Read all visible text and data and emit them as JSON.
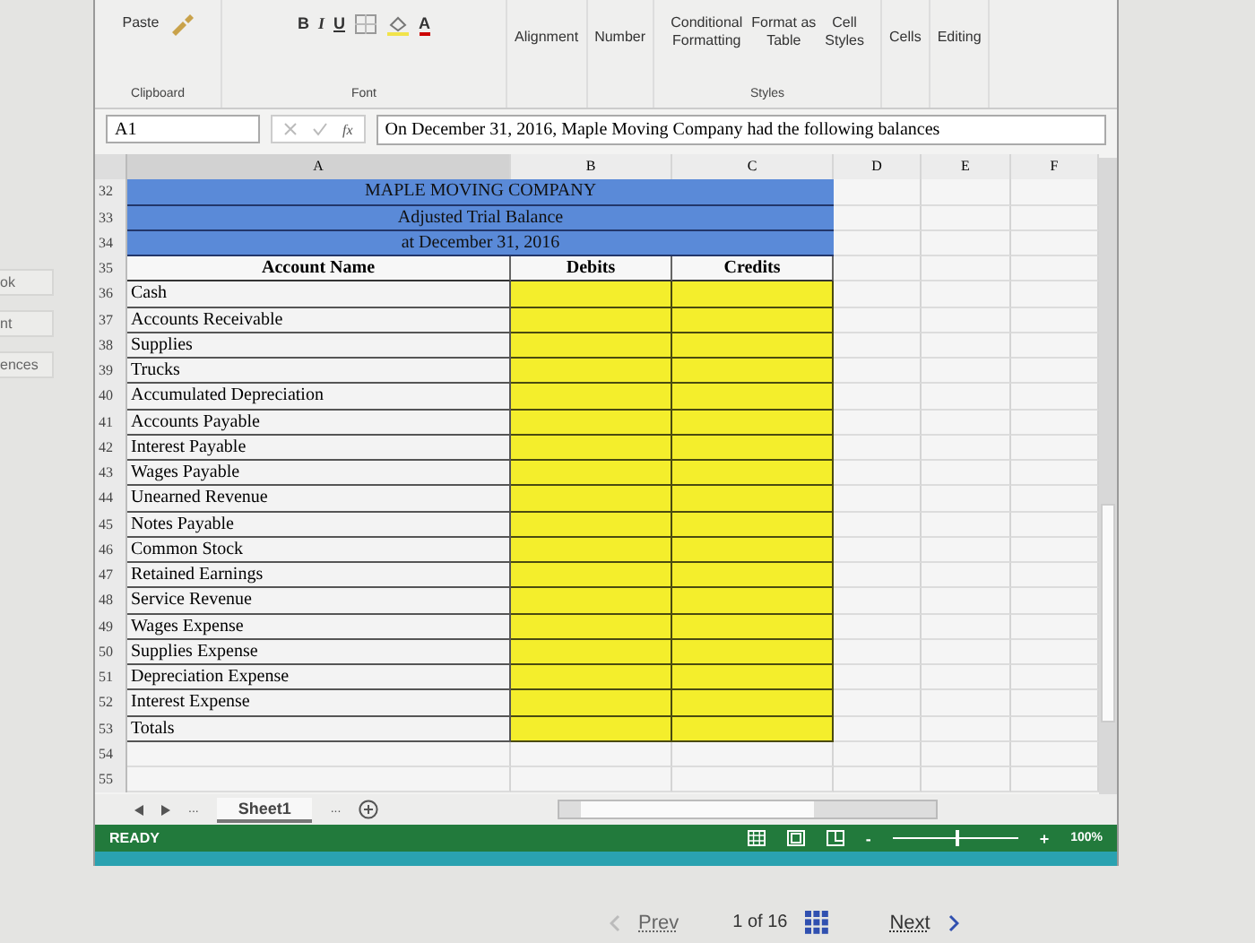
{
  "side_labels": [
    "ok",
    "nt",
    "ences"
  ],
  "ribbon": {
    "paste": "Paste",
    "clipboard": "Clipboard",
    "font_buttons": [
      "B",
      "I",
      "U"
    ],
    "font_color": "A",
    "font": "Font",
    "alignment": "Alignment",
    "number": "Number",
    "styles": [
      [
        "Conditional",
        "Formatting"
      ],
      [
        "Format as",
        "Table"
      ],
      [
        "Cell",
        "Styles"
      ]
    ],
    "styles_label": "Styles",
    "cells": "Cells",
    "editing": "Editing"
  },
  "formula_bar": {
    "name_box": "A1",
    "fx": "fx",
    "value": "On December 31, 2016, Maple Moving Company had the following balances"
  },
  "columns": [
    "A",
    "B",
    "C",
    "D",
    "E",
    "F"
  ],
  "rows": [
    {
      "num": "32",
      "kind": "title",
      "text": "MAPLE MOVING COMPANY"
    },
    {
      "num": "33",
      "kind": "title",
      "text": "Adjusted Trial Balance"
    },
    {
      "num": "34",
      "kind": "title",
      "text": "at December 31, 2016"
    },
    {
      "num": "35",
      "kind": "header",
      "cells": [
        "Account Name",
        "Debits",
        "Credits"
      ]
    },
    {
      "num": "36",
      "kind": "account",
      "text": "Cash"
    },
    {
      "num": "37",
      "kind": "account",
      "text": "Accounts Receivable"
    },
    {
      "num": "38",
      "kind": "account",
      "text": "Supplies"
    },
    {
      "num": "39",
      "kind": "account",
      "text": "Trucks"
    },
    {
      "num": "40",
      "kind": "account",
      "text": "Accumulated Depreciation"
    },
    {
      "num": "41",
      "kind": "account",
      "text": "Accounts Payable"
    },
    {
      "num": "42",
      "kind": "account",
      "text": "Interest Payable"
    },
    {
      "num": "43",
      "kind": "account",
      "text": "Wages Payable"
    },
    {
      "num": "44",
      "kind": "account",
      "text": "Unearned Revenue"
    },
    {
      "num": "45",
      "kind": "account",
      "text": "Notes Payable"
    },
    {
      "num": "46",
      "kind": "account",
      "text": "Common Stock"
    },
    {
      "num": "47",
      "kind": "account",
      "text": "Retained Earnings"
    },
    {
      "num": "48",
      "kind": "account",
      "text": "Service Revenue"
    },
    {
      "num": "49",
      "kind": "account",
      "text": "Wages Expense"
    },
    {
      "num": "50",
      "kind": "account",
      "text": "Supplies Expense"
    },
    {
      "num": "51",
      "kind": "account",
      "text": "Depreciation Expense"
    },
    {
      "num": "52",
      "kind": "account",
      "text": "Interest Expense"
    },
    {
      "num": "53",
      "kind": "account",
      "text": "Totals"
    },
    {
      "num": "54",
      "kind": "empty"
    },
    {
      "num": "55",
      "kind": "empty"
    }
  ],
  "sheet_tabs": [
    {
      "label": "Sheet1",
      "selected": true
    }
  ],
  "ellipses": [
    "...",
    "..."
  ],
  "status": {
    "text": "READY",
    "zoom_minus": "-",
    "zoom_plus": "+",
    "zoom": "100%",
    "level": 0.5
  },
  "pager": {
    "prev": "Prev",
    "position": "1 of 16",
    "next": "Next"
  }
}
